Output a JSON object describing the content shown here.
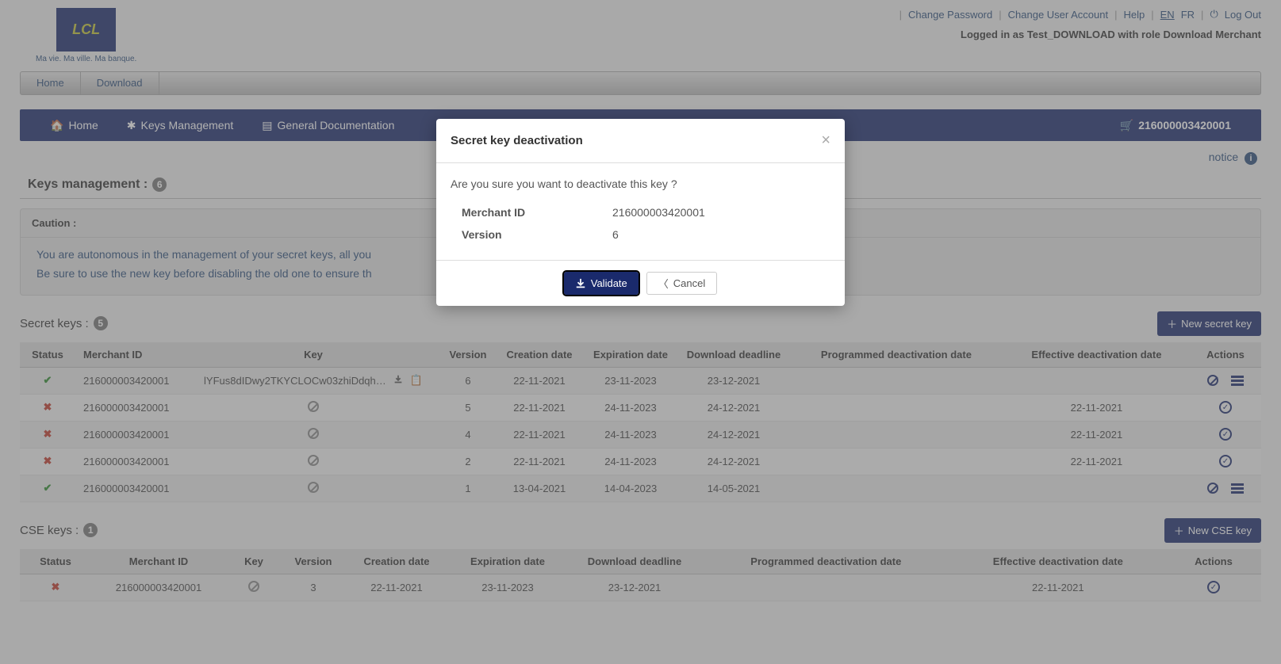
{
  "logo": {
    "text": "LCL",
    "tagline": "Ma vie. Ma ville. Ma banque."
  },
  "top_links": {
    "change_password": "Change Password",
    "change_user": "Change User Account",
    "help": "Help",
    "lang_en": "EN",
    "lang_fr": "FR",
    "logout": "Log Out"
  },
  "logged_in": "Logged in as Test_DOWNLOAD with role Download Merchant",
  "nav1": {
    "home": "Home",
    "download": "Download"
  },
  "nav2": {
    "home": "Home",
    "keys_mgmt": "Keys Management",
    "general_doc": "General Documentation",
    "merchant_id": "216000003420001"
  },
  "notice": "notice",
  "sections": {
    "keys_mgmt_title": "Keys management :",
    "keys_mgmt_count": "6",
    "caution_label": "Caution :",
    "caution_line1": "You are autonomous in the management of your secret keys, all you",
    "caution_line2": "Be sure to use the new key before disabling the old one to ensure th",
    "secret_keys_title": "Secret keys :",
    "secret_keys_count": "5",
    "new_secret_key": "New secret key",
    "cse_keys_title": "CSE keys :",
    "cse_keys_count": "1",
    "new_cse_key": "New CSE key"
  },
  "secret_table": {
    "headers": {
      "status": "Status",
      "merchant_id": "Merchant ID",
      "key": "Key",
      "version": "Version",
      "creation": "Creation date",
      "expiration": "Expiration date",
      "download_deadline": "Download deadline",
      "prog_deact": "Programmed deactivation date",
      "eff_deact": "Effective deactivation date",
      "actions": "Actions"
    },
    "rows": [
      {
        "status": "ok",
        "merchant": "216000003420001",
        "key_text": "lYFus8dIDwy2TKYCLOCw03zhiDdqh…",
        "key_icons": true,
        "version": "6",
        "creation": "22-11-2021",
        "expiration": "23-11-2023",
        "dl_deadline": "23-12-2021",
        "prog": "",
        "eff": "",
        "actions": "ban_bars"
      },
      {
        "status": "bad",
        "merchant": "216000003420001",
        "key_text": "",
        "key_icons": false,
        "version": "5",
        "creation": "22-11-2021",
        "expiration": "24-11-2023",
        "dl_deadline": "24-12-2021",
        "prog": "",
        "eff": "22-11-2021",
        "actions": "chk"
      },
      {
        "status": "bad",
        "merchant": "216000003420001",
        "key_text": "",
        "key_icons": false,
        "version": "4",
        "creation": "22-11-2021",
        "expiration": "24-11-2023",
        "dl_deadline": "24-12-2021",
        "prog": "",
        "eff": "22-11-2021",
        "actions": "chk"
      },
      {
        "status": "bad",
        "merchant": "216000003420001",
        "key_text": "",
        "key_icons": false,
        "version": "2",
        "creation": "22-11-2021",
        "expiration": "24-11-2023",
        "dl_deadline": "24-12-2021",
        "prog": "",
        "eff": "22-11-2021",
        "actions": "chk"
      },
      {
        "status": "ok",
        "merchant": "216000003420001",
        "key_text": "",
        "key_icons": false,
        "version": "1",
        "creation": "13-04-2021",
        "expiration": "14-04-2023",
        "dl_deadline": "14-05-2021",
        "prog": "",
        "eff": "",
        "actions": "ban_bars"
      }
    ]
  },
  "cse_table": {
    "headers": {
      "status": "Status",
      "merchant_id": "Merchant ID",
      "key": "Key",
      "version": "Version",
      "creation": "Creation date",
      "expiration": "Expiration date",
      "download_deadline": "Download deadline",
      "prog_deact": "Programmed deactivation date",
      "eff_deact": "Effective deactivation date",
      "actions": "Actions"
    },
    "rows": [
      {
        "status": "bad",
        "merchant": "216000003420001",
        "key_text": "",
        "version": "3",
        "creation": "22-11-2021",
        "expiration": "23-11-2023",
        "dl_deadline": "23-12-2021",
        "prog": "",
        "eff": "22-11-2021",
        "actions": "chk"
      }
    ]
  },
  "modal": {
    "title": "Secret key deactivation",
    "question": "Are you sure you want to deactivate this key ?",
    "merchant_label": "Merchant ID",
    "merchant_value": "216000003420001",
    "version_label": "Version",
    "version_value": "6",
    "validate": "Validate",
    "cancel": "Cancel"
  }
}
